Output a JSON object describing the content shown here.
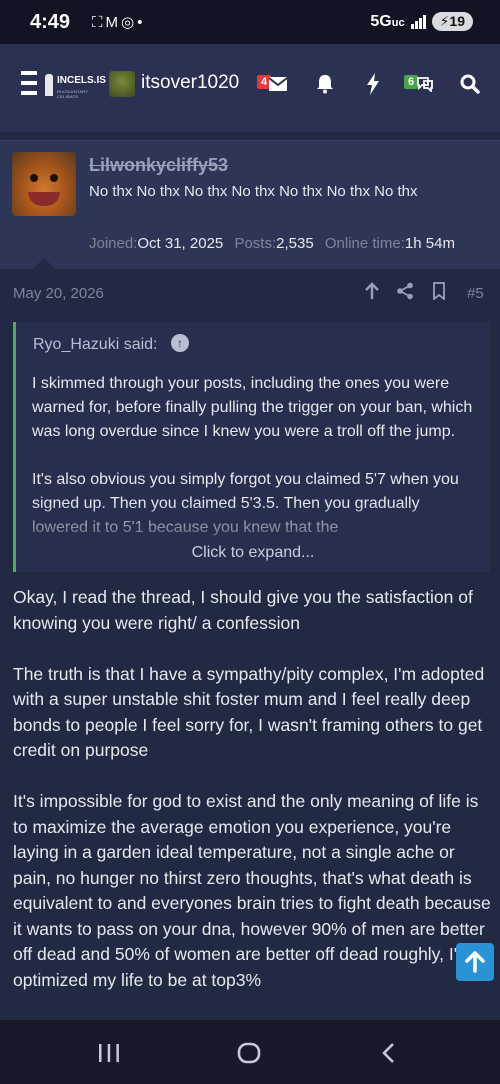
{
  "status_bar": {
    "time": "4:49",
    "network": "5G",
    "network_suffix": "uc",
    "battery": "19"
  },
  "header": {
    "logo_text": "INCELS.IS",
    "logo_subtitle": "INVOLUNTARY CELIBATE",
    "username": "itsover1020",
    "inbox_count": "4",
    "alerts_count": "6"
  },
  "post": {
    "author": "Lilwonkycliffy53",
    "user_title": "No thx No thx No thx No thx No thx No thx No thx",
    "joined_label": "Joined:",
    "joined_value": "Oct 31, 2025",
    "posts_label": "Posts:",
    "posts_value": "2,535",
    "online_label": "Online time:",
    "online_value": "1h 54m",
    "date": "May 20, 2026",
    "number": "#5"
  },
  "quote": {
    "author": "Ryo_Hazuki said:",
    "paragraphs": [
      "I skimmed through your posts, including the ones you were warned for, before finally pulling the trigger on your ban, which was long overdue since I knew you were a troll off the jump.",
      "It's also obvious you simply forgot you claimed 5'7 when you signed up. Then you claimed 5'3.5. Then you gradually lowered it to 5'1 because you knew that the"
    ],
    "expand_label": "Click to expand..."
  },
  "message": {
    "paragraphs": [
      "Okay, I read the thread, I should give you the satisfaction of knowing you were right/ a confession",
      "The truth is that I have a sympathy/pity complex, I'm adopted with a super unstable shit foster mum and I feel really deep bonds to people I feel sorry for, I wasn't framing others to get credit on purpose",
      "It's impossible for god to exist and the only meaning of life is to maximize the average emotion you experience, you're laying in a garden ideal temperature, not a single ache or pain, no hunger no thirst zero thoughts, that's what death is equivalent to and everyones brain tries to fight death because it wants to pass on your dna, however 90% of men are better off dead and 50% of women are better off dead roughly, I've optimized my life to be at top3%"
    ]
  },
  "colors": {
    "background": "#222943",
    "header": "#2a3152",
    "quote_border": "#4caf50",
    "badge_red": "#e03a3a",
    "badge_green": "#47a447",
    "scroll_button": "#2a93d5"
  }
}
